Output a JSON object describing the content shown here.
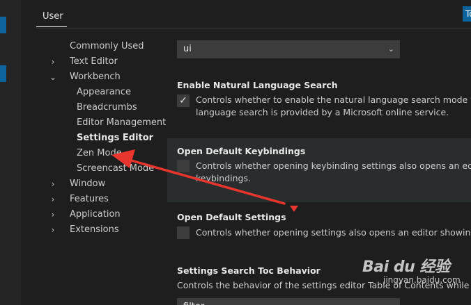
{
  "tabs": {
    "user": "User",
    "workspace": "To"
  },
  "toc": {
    "items": [
      {
        "label": "Commonly Used",
        "chevron": "",
        "level": 0
      },
      {
        "label": "Text Editor",
        "chevron": "›",
        "level": 0
      },
      {
        "label": "Workbench",
        "chevron": "⌄",
        "level": 0
      },
      {
        "label": "Appearance",
        "chevron": "",
        "level": 1
      },
      {
        "label": "Breadcrumbs",
        "chevron": "",
        "level": 1
      },
      {
        "label": "Editor Management",
        "chevron": "",
        "level": 1
      },
      {
        "label": "Settings Editor",
        "chevron": "",
        "level": 1,
        "active": true
      },
      {
        "label": "Zen Mode",
        "chevron": "",
        "level": 1
      },
      {
        "label": "Screencast Mode",
        "chevron": "",
        "level": 1
      },
      {
        "label": "Window",
        "chevron": "›",
        "level": 0
      },
      {
        "label": "Features",
        "chevron": "›",
        "level": 0
      },
      {
        "label": "Application",
        "chevron": "›",
        "level": 0
      },
      {
        "label": "Extensions",
        "chevron": "›",
        "level": 0
      }
    ]
  },
  "settings": {
    "dropdown_value": "ui",
    "natural_language": {
      "title": "Enable Natural Language Search",
      "desc_line1": "Controls whether to enable the natural language search mode for set",
      "desc_line2": "language search is provided by a Microsoft online service.",
      "checked": true
    },
    "default_keybindings": {
      "title": "Open Default Keybindings",
      "desc_line1": "Controls whether opening keybinding settings also opens an editor s",
      "desc_line2": "keybindings.",
      "checked": false
    },
    "default_settings": {
      "title": "Open Default Settings",
      "desc_line1": "Controls whether opening settings also opens an editor showing all d",
      "checked": false
    },
    "toc_behavior": {
      "title": "Settings Search Toc Behavior",
      "desc": "Controls the behavior of the settings editor Table of Contents while search",
      "dropdown_value": "filter"
    }
  },
  "icons": {
    "check": "check-icon",
    "chevron": "chevron-down-icon"
  },
  "colors": {
    "arrow": "#e8352e",
    "accent": "#0e639c"
  },
  "watermark": {
    "logo": "Bai du 经验",
    "sub": "jingyan.baidu.com"
  }
}
